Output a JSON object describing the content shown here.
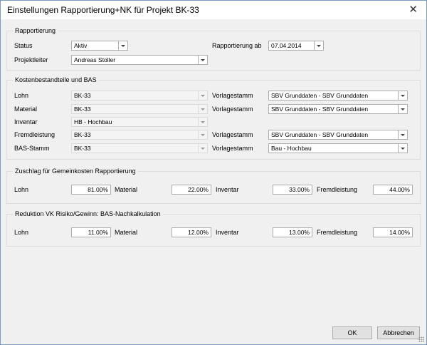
{
  "window": {
    "title": "Einstellungen Rapportierung+NK für Projekt BK-33",
    "close_glyph": "✕"
  },
  "rapportierung": {
    "title": "Rapportierung",
    "status_label": "Status",
    "status_value": "Aktiv",
    "leiter_label": "Projektleiter",
    "leiter_value": "Andreas Stoller",
    "ab_label": "Rapportierung ab",
    "ab_value": "07.04.2014"
  },
  "kosten": {
    "title": "Kostenbestandteile und BAS",
    "rows": [
      {
        "label": "Lohn",
        "value": "BK-33",
        "vorlage_label": "Vorlagestamm",
        "vorlage_value": "SBV Grunddaten - SBV Grunddaten"
      },
      {
        "label": "Material",
        "value": "BK-33",
        "vorlage_label": "Vorlagestamm",
        "vorlage_value": "SBV Grunddaten - SBV Grunddaten"
      },
      {
        "label": "Inventar",
        "value": "HB - Hochbau"
      },
      {
        "label": "Fremdleistung",
        "value": "BK-33",
        "vorlage_label": "Vorlagestamm",
        "vorlage_value": "SBV Grunddaten - SBV Grunddaten"
      },
      {
        "label": "BAS-Stamm",
        "value": "BK-33",
        "vorlage_label": "Vorlagestamm",
        "vorlage_value": "Bau - Hochbau"
      }
    ]
  },
  "zuschlag": {
    "title": "Zuschlag für Gemeinkosten Rapportierung",
    "items": [
      {
        "label": "Lohn",
        "value": "81.00%"
      },
      {
        "label": "Material",
        "value": "22.00%"
      },
      {
        "label": "Inventar",
        "value": "33.00%"
      },
      {
        "label": "Fremdleistung",
        "value": "44.00%"
      }
    ]
  },
  "reduktion": {
    "title": "Reduktion VK Risiko/Gewinn: BAS-Nachkalkulation",
    "items": [
      {
        "label": "Lohn",
        "value": "11.00%"
      },
      {
        "label": "Material",
        "value": "12.00%"
      },
      {
        "label": "Inventar",
        "value": "13.00%"
      },
      {
        "label": "Fremdleistung",
        "value": "14.00%"
      }
    ]
  },
  "buttons": {
    "ok": "OK",
    "cancel": "Abbrechen"
  }
}
